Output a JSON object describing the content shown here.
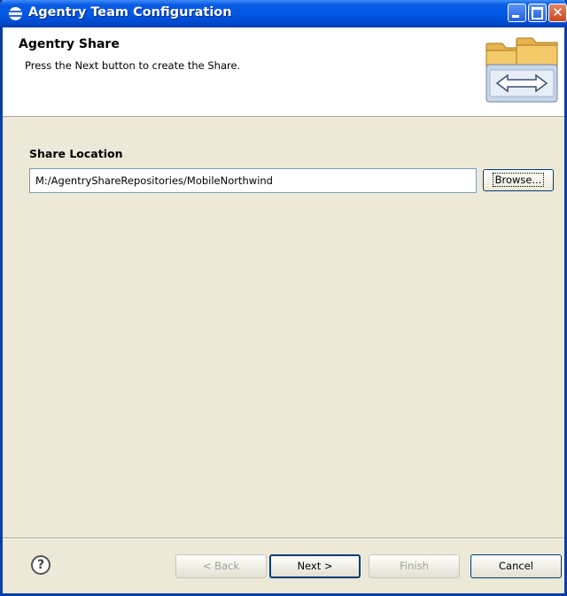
{
  "window": {
    "title": "Agentry Team Configuration"
  },
  "banner": {
    "title": "Agentry Share",
    "message": "Press the Next button to create the Share."
  },
  "share": {
    "label": "Share Location",
    "path": "M:/AgentryShareRepositories/MobileNorthwind",
    "browse_label": "Browse..."
  },
  "footer": {
    "help_glyph": "?",
    "back_label": "< Back",
    "next_label": "Next >",
    "finish_label": "Finish",
    "cancel_label": "Cancel"
  },
  "colors": {
    "titlebar": "#0058e6",
    "dialog_bg": "#ece9d8",
    "banner_bg": "#ffffff"
  },
  "icons": {
    "title": "eclipse-icon",
    "banner": "folder-sync-icon",
    "help": "help-icon"
  }
}
